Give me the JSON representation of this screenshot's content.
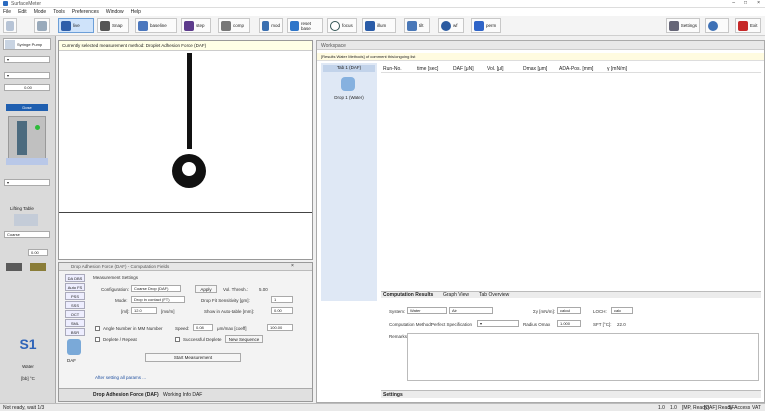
{
  "app": {
    "title": "SurfaceMeter",
    "status_left": "Not ready, wait 1/3"
  },
  "menu": [
    "File",
    "Edit",
    "Mode",
    "Tools",
    "Preferences",
    "Window",
    "Help"
  ],
  "toolbar": {
    "live": "live",
    "snap": "Snap",
    "baseline": "baseline",
    "step": "step",
    "comp": "comp",
    "mod": "mod",
    "reset": "reset base",
    "focus": "focus",
    "illum": "illum",
    "tilt": "tilt",
    "wf": "wf",
    "run": "perm",
    "settings": "Settings",
    "exit": "Exit"
  },
  "left": {
    "syringe": "Syringe Pump",
    "vol": "0.00",
    "volunit": "μl",
    "dose": "Dose",
    "lift_title": "Lifting Table",
    "lift": "Coarse",
    "lift_val": "0.00",
    "s1": "S1",
    "s1_name": "Water",
    "temp": "[bb] °C"
  },
  "center": {
    "method": "Currently selected measurement method: Droplet Adhesion Force (DAF)"
  },
  "results": {
    "title": "Workspace",
    "msg": "[Results Water Methods] of comment this/ongoing list",
    "tab": "Tab 1 (DAF)",
    "drop": "Drop 1 (Water)",
    "cols": [
      "Run-No.",
      "time [sec]",
      "DAF [μN]",
      "Vol. [μl]",
      "Dmax [μm]",
      "ADA-Pos. [mm]",
      "γ [mN/m]"
    ],
    "bottom_tabs": [
      "Computation Results",
      "Graph View",
      "Tab Overview"
    ],
    "system_label": "System:",
    "system": "Water",
    "sub": "Air",
    "sigma_l": "Σγ [mN/m]:",
    "sigma_v": "calcul",
    "loch_l": "LOCH:",
    "loch_v": "calc",
    "cm_l": "Computation Method:",
    "cm": "Perfect Specification",
    "lbl2": "Radius  Omax",
    "lbl2v": "1.000",
    "rr_l": "SFT [°C]:",
    "rr_v": "22.0",
    "remarks": "Remarks:",
    "settings_tab": "Settings"
  },
  "dialog": {
    "title": "Drop Adhesion Force (DAF) - Computation Fields",
    "group": "Measurement Settings",
    "config_l": "Configuration:",
    "config": "Coarse Drop (DAF)",
    "apply": "Apply",
    "vol_l": "Vol. Thresh.:",
    "vol": "5.00",
    "mode_l": "Mode:",
    "mode": "Drop in contact (FT)",
    "force_l": "Drop Fit Sensitivity [gm]:",
    "force": "1",
    "f1_l": "[ml]:",
    "f1": "12.0",
    "f1u": "[ms/m]",
    "shw_l": "Show in Auto-table [mm]:",
    "shw": "0.00",
    "sep_l": "Angle Number in MM Number",
    "spd_l": "Speed:",
    "spd": "0.08",
    "spdu": "μm/max [coeff]",
    "spd2": "100.00",
    "cb2": "Deplete / Repeat",
    "cb3": "Successful Deplete",
    "newseq": "New Sequence",
    "start": "Start Measurement",
    "after": "After setting all params ...",
    "side": [
      "DA DBS",
      "Auto FS",
      "PSS",
      "SSS",
      "OCT",
      "SML",
      "BSR"
    ],
    "daf": "DAF",
    "tabs": [
      "Drop Adhesion Force (DAF)",
      "Working Info DAF"
    ]
  },
  "status": {
    "r1": "1.0",
    "r2": "1.0",
    "r3": "[MP, Ready]",
    "r4": "[DAF] Ready",
    "r5": "SFAccess",
    "r6": "VAT"
  }
}
